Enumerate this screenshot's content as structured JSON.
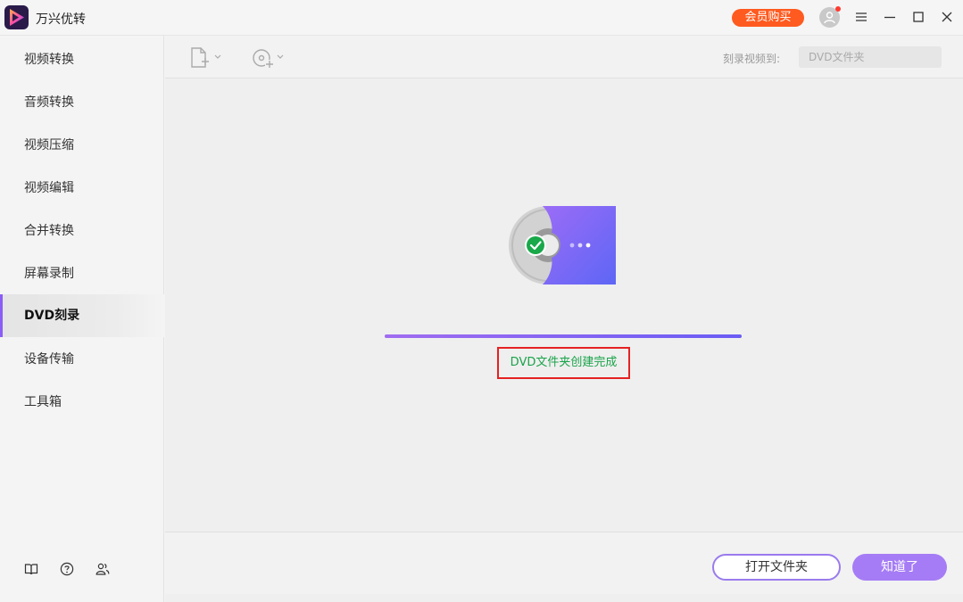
{
  "app": {
    "title": "万兴优转"
  },
  "titlebar": {
    "vip_label": "会员购买",
    "icons": [
      "avatar-icon",
      "menu-icon",
      "minimize-icon",
      "maximize-icon",
      "close-icon"
    ]
  },
  "sidebar": {
    "items": [
      {
        "label": "视频转换",
        "active": false
      },
      {
        "label": "音频转换",
        "active": false
      },
      {
        "label": "视频压缩",
        "active": false
      },
      {
        "label": "视频编辑",
        "active": false
      },
      {
        "label": "合并转换",
        "active": false
      },
      {
        "label": "屏幕录制",
        "active": false
      },
      {
        "label": "DVD刻录",
        "active": true
      },
      {
        "label": "设备传输",
        "active": false
      },
      {
        "label": "工具箱",
        "active": false
      }
    ],
    "footer_icons": [
      "book-icon",
      "help-icon",
      "users-icon"
    ]
  },
  "toolbar": {
    "icons": [
      "add-file-icon",
      "add-disc-icon"
    ],
    "burn_to_label": "刻录视频到:",
    "destination_value": "DVD文件夹"
  },
  "status": {
    "progress_fraction": 1.0,
    "message": "DVD文件夹创建完成"
  },
  "footer": {
    "open_folder_label": "打开文件夹",
    "ok_label": "知道了"
  },
  "colors": {
    "accent": "#a57cf5",
    "vip": "#ff5a1f",
    "success": "#1aa34a",
    "highlight_border": "#e52222"
  }
}
